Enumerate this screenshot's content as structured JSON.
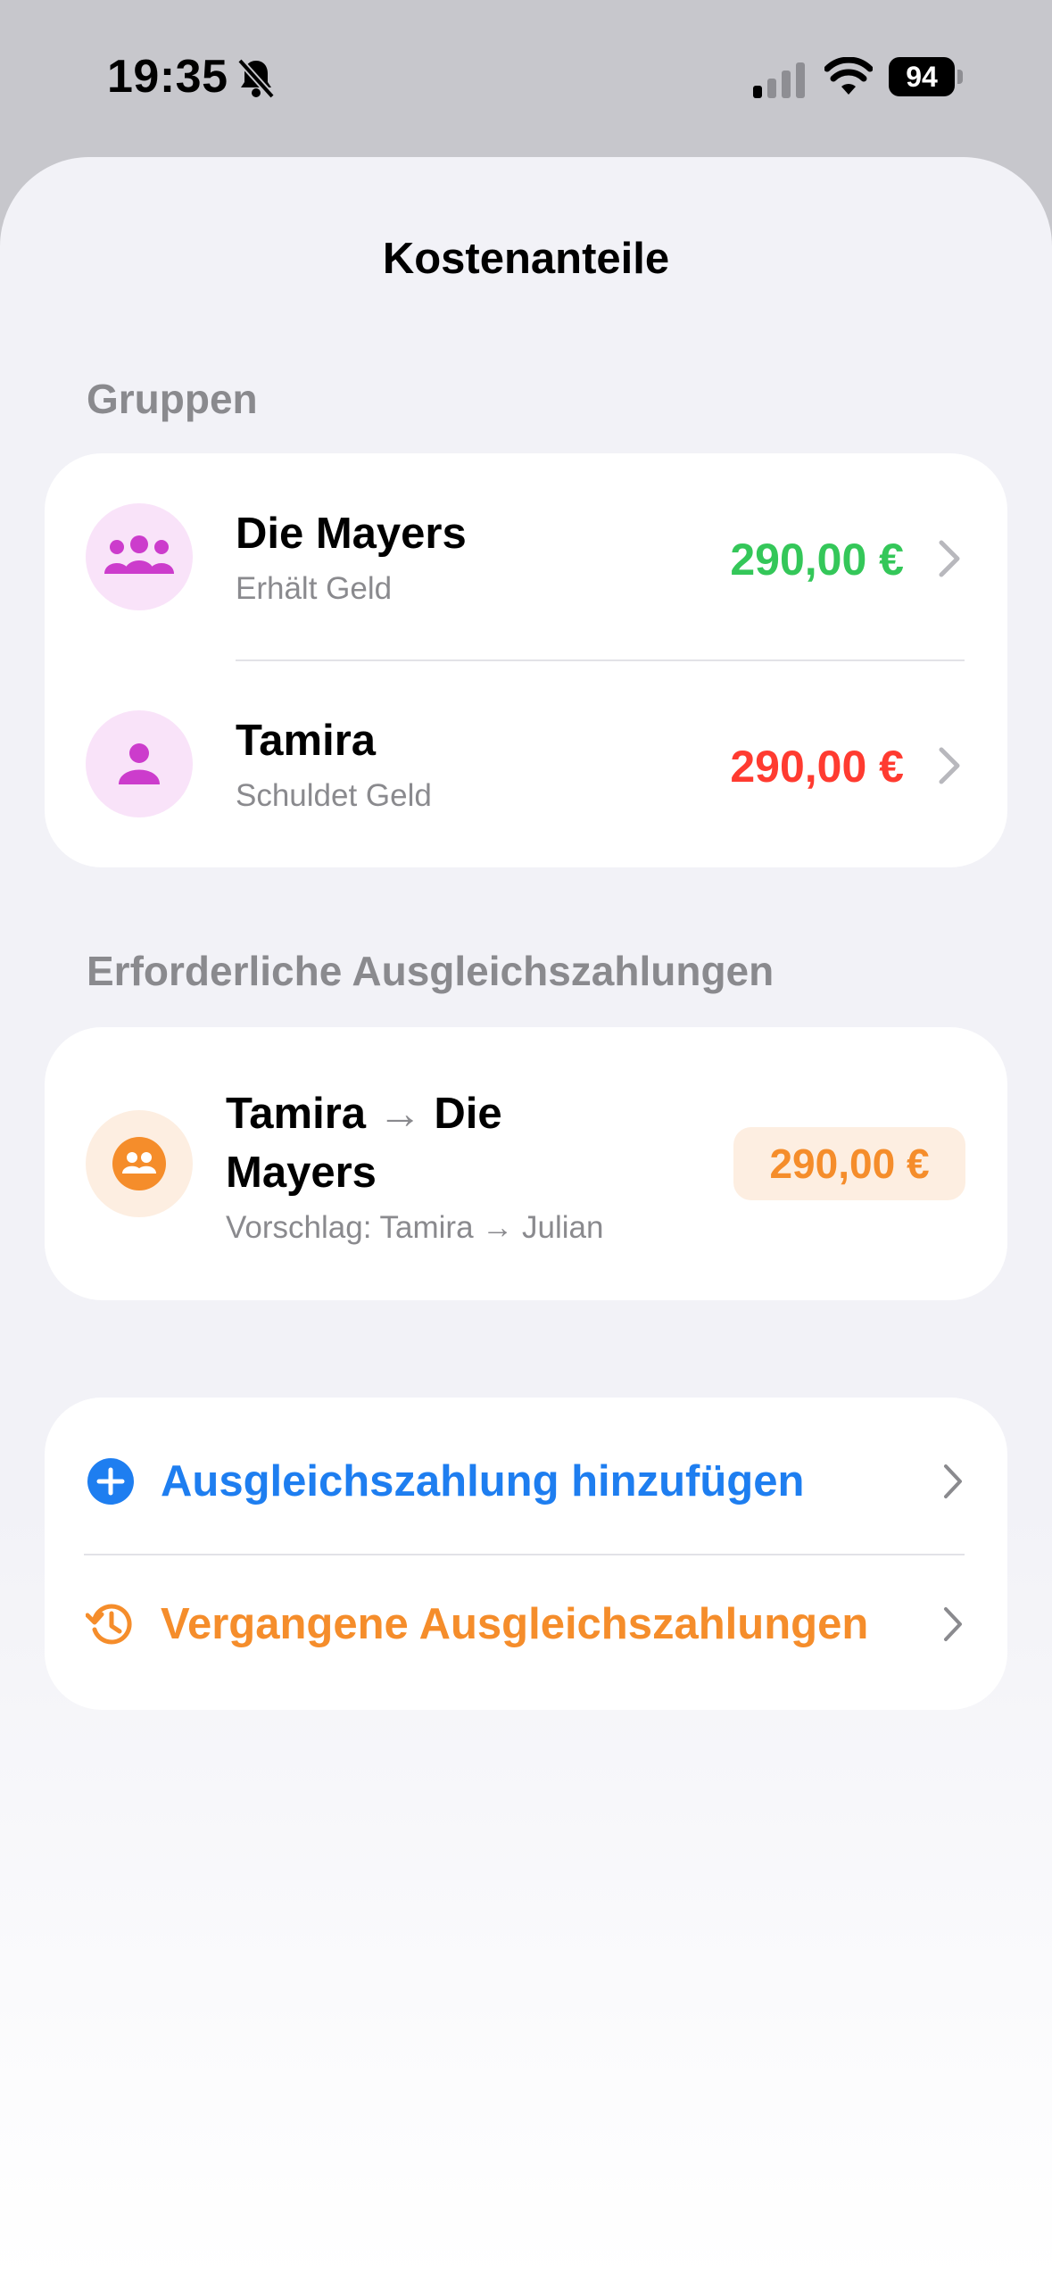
{
  "status_bar": {
    "time": "19:35",
    "battery": "94",
    "icons": [
      "bell-slash-icon",
      "cellular-signal-icon",
      "wifi-icon",
      "battery-icon"
    ]
  },
  "sheet": {
    "title": "Kostenanteile"
  },
  "groups": {
    "header": "Gruppen",
    "items": [
      {
        "name": "Die Mayers",
        "status": "Erhält Geld",
        "amount": "290,00 €",
        "amount_color": "#34c759",
        "icon": "people-group-icon"
      },
      {
        "name": "Tamira",
        "status": "Schuldet Geld",
        "amount": "290,00 €",
        "amount_color": "#ff3b30",
        "icon": "person-icon"
      }
    ]
  },
  "settlements": {
    "header": "Erforderliche Ausgleichszahlungen",
    "items": [
      {
        "from": "Tamira",
        "arrow": "→",
        "to": "Die Mayers",
        "suggestion": "Vorschlag: Tamira → Julian",
        "amount": "290,00 €",
        "icon": "people-circle-icon"
      }
    ]
  },
  "actions": [
    {
      "label": "Ausgleichszahlung hinzufügen",
      "color": "#1e7ef0",
      "icon": "plus-circle-icon"
    },
    {
      "label": "Vergangene Ausgleichszahlungen",
      "color": "#f58d2b",
      "icon": "clock-history-icon"
    }
  ],
  "colors": {
    "accent_purple": "#cc3ccc",
    "accent_orange": "#f58d2b",
    "accent_blue": "#1e7ef0",
    "positive": "#34c759",
    "negative": "#ff3b30"
  }
}
